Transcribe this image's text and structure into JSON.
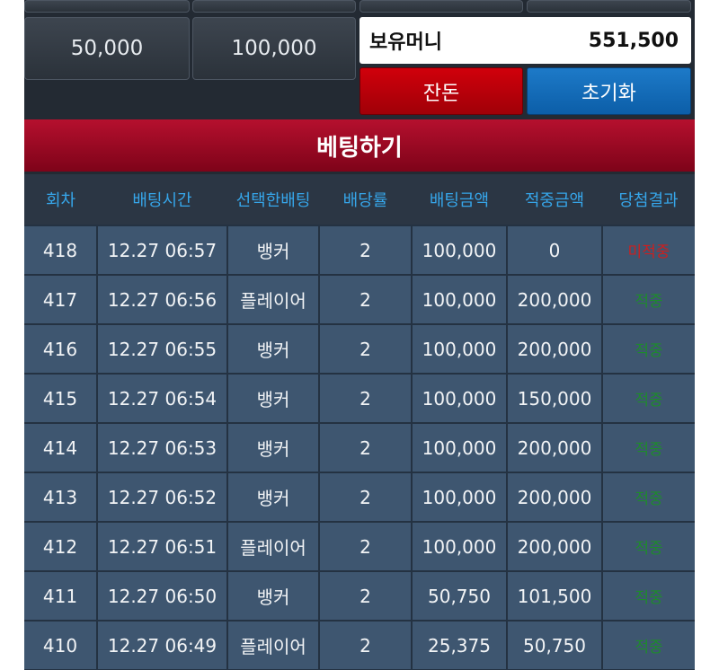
{
  "chips": [
    {
      "label": ""
    },
    {
      "label": ""
    },
    {
      "label": "50,000"
    },
    {
      "label": "100,000"
    }
  ],
  "balance": {
    "label": "보유머니",
    "value": "551,500"
  },
  "buttons": {
    "change_label": "잔돈",
    "reset_label": "초기화"
  },
  "section": {
    "title": "베팅하기"
  },
  "colors": {
    "header": "#b5102e",
    "change": "#c0000a",
    "reset": "#1a74c2",
    "pending": "#cc1f1f",
    "hit": "#1e8b2c",
    "column_header": "#36a6ea"
  },
  "table": {
    "headers": [
      "회차",
      "배팅시간",
      "선택한배팅",
      "배당률",
      "배팅금액",
      "적중금액",
      "당첨결과"
    ],
    "rows": [
      {
        "round": "418",
        "time": "12.27 06:57",
        "choice": "뱅커",
        "odds": "2",
        "bet": "100,000",
        "win": "0",
        "result": "미적중"
      },
      {
        "round": "417",
        "time": "12.27 06:56",
        "choice": "플레이어",
        "odds": "2",
        "bet": "100,000",
        "win": "200,000",
        "result": "적중"
      },
      {
        "round": "416",
        "time": "12.27 06:55",
        "choice": "뱅커",
        "odds": "2",
        "bet": "100,000",
        "win": "200,000",
        "result": "적중"
      },
      {
        "round": "415",
        "time": "12.27 06:54",
        "choice": "뱅커",
        "odds": "2",
        "bet": "100,000",
        "win": "150,000",
        "result": "적중"
      },
      {
        "round": "414",
        "time": "12.27 06:53",
        "choice": "뱅커",
        "odds": "2",
        "bet": "100,000",
        "win": "200,000",
        "result": "적중"
      },
      {
        "round": "413",
        "time": "12.27 06:52",
        "choice": "뱅커",
        "odds": "2",
        "bet": "100,000",
        "win": "200,000",
        "result": "적중"
      },
      {
        "round": "412",
        "time": "12.27 06:51",
        "choice": "플레이어",
        "odds": "2",
        "bet": "100,000",
        "win": "200,000",
        "result": "적중"
      },
      {
        "round": "411",
        "time": "12.27 06:50",
        "choice": "뱅커",
        "odds": "2",
        "bet": "50,750",
        "win": "101,500",
        "result": "적중"
      },
      {
        "round": "410",
        "time": "12.27 06:49",
        "choice": "플레이어",
        "odds": "2",
        "bet": "25,375",
        "win": "50,750",
        "result": "적중"
      }
    ]
  }
}
